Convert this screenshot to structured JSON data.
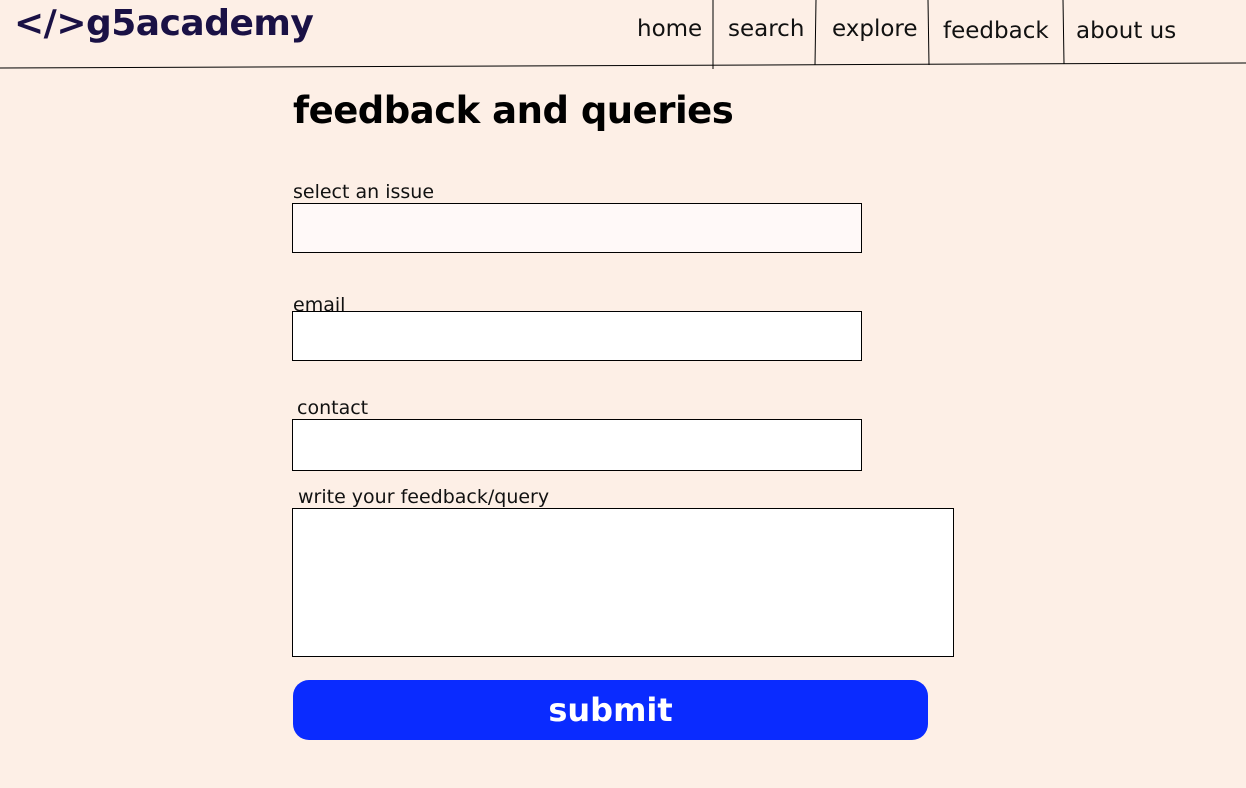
{
  "header": {
    "logo": "</>g5academy",
    "nav": {
      "home": "home",
      "search": "search",
      "explore": "explore",
      "feedback": "feedback",
      "about": "about us"
    }
  },
  "main": {
    "title": "feedback and queries",
    "fields": {
      "issue": {
        "label": "select an issue",
        "value": ""
      },
      "email": {
        "label": "email",
        "value": ""
      },
      "contact": {
        "label": "contact",
        "value": ""
      },
      "feedback": {
        "label": "write your feedback/query",
        "value": ""
      }
    },
    "submit_label": "submit"
  },
  "colors": {
    "background": "#fdefe6",
    "logo": "#1a1145",
    "accent": "#0a2bff",
    "button_text": "#ffffff"
  }
}
